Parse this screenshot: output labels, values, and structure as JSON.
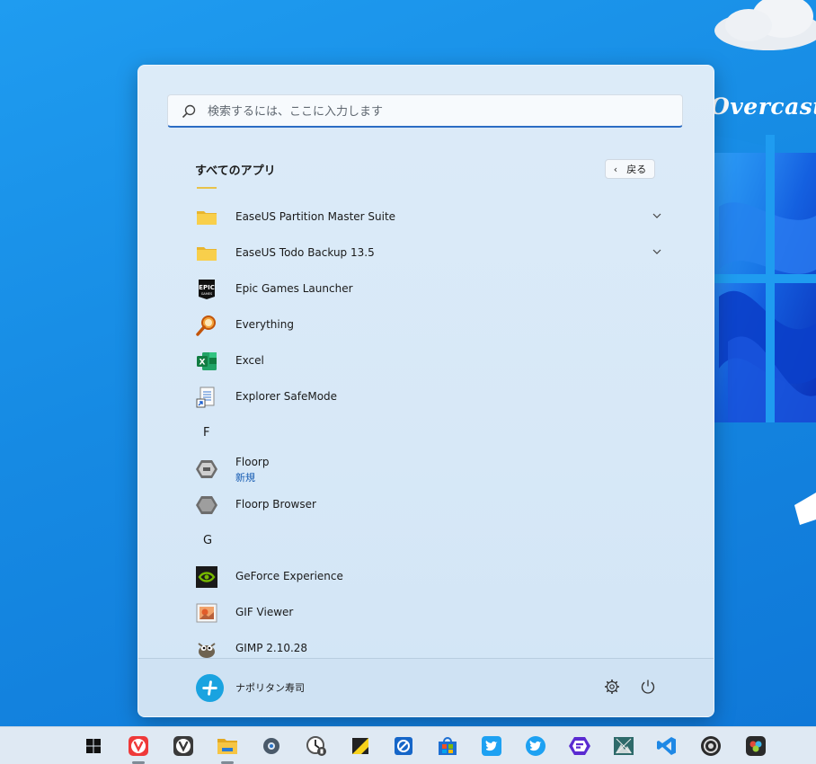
{
  "desktop": {
    "wallpaper_text": "Overcast"
  },
  "start_menu": {
    "search": {
      "placeholder": "検索するには、ここに入力します"
    },
    "section_title": "すべてのアプリ",
    "back_label": "戻る",
    "items": [
      {
        "label": "EaseUS Partition Master Suite",
        "icon": "folder-icon",
        "expandable": true
      },
      {
        "label": "EaseUS Todo Backup 13.5",
        "icon": "folder-icon",
        "expandable": true
      },
      {
        "label": "Epic Games Launcher",
        "icon": "epic-games-icon",
        "icon_text": "EPIC",
        "icon_subtext": "GAMES"
      },
      {
        "label": "Everything",
        "icon": "magnifier-icon"
      },
      {
        "label": "Excel",
        "icon": "excel-icon",
        "icon_text": "X"
      },
      {
        "label": "Explorer SafeMode",
        "icon": "explorer-shortcut-icon"
      },
      {
        "letter": "F"
      },
      {
        "label": "Floorp",
        "sublabel": "新規",
        "icon": "floorp-icon"
      },
      {
        "label": "Floorp Browser",
        "icon": "floorp-browser-icon"
      },
      {
        "letter": "G"
      },
      {
        "label": "GeForce Experience",
        "icon": "nvidia-icon"
      },
      {
        "label": "GIF Viewer",
        "icon": "gif-viewer-icon"
      },
      {
        "label": "GIMP 2.10.28",
        "icon": "gimp-icon"
      }
    ],
    "user": {
      "name": "ナポリタン寿司"
    }
  },
  "taskbar": {
    "items": [
      {
        "name": "windows-start-icon"
      },
      {
        "name": "vivaldi-icon",
        "color": "#ef3939"
      },
      {
        "name": "vivaldi-snapshot-icon",
        "color": "#3a3a3a"
      },
      {
        "name": "file-explorer-icon",
        "color": "#f6c544"
      },
      {
        "name": "settings-icon",
        "color": "#4a5a6a"
      },
      {
        "name": "clock-app-icon",
        "color": "#555555"
      },
      {
        "name": "sticky-notes-icon",
        "color": "#f7d21c"
      },
      {
        "name": "blocked-app-icon",
        "color": "#1666c8"
      },
      {
        "name": "microsoft-store-icon",
        "color": "#1d6fd2"
      },
      {
        "name": "twitter-icon",
        "color": "#1da1f2"
      },
      {
        "name": "twitter-circle-icon",
        "color": "#1da1f2"
      },
      {
        "name": "floorp-taskbar-icon",
        "color": "#5a2bd1"
      },
      {
        "name": "image-app-icon",
        "color": "#2e6a6a"
      },
      {
        "name": "vscode-icon",
        "color": "#1e88e5"
      },
      {
        "name": "obs-icon",
        "color": "#2b2b2b"
      },
      {
        "name": "davinci-resolve-icon",
        "color": "#2a2a2a"
      }
    ]
  }
}
